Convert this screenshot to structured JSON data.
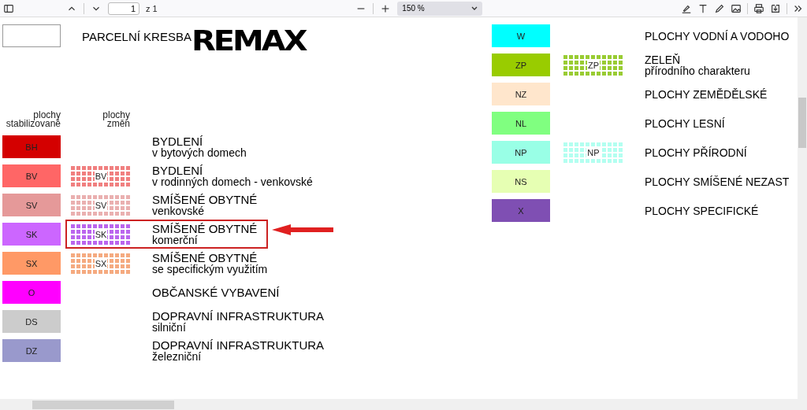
{
  "toolbar": {
    "page_number": "1",
    "page_count": "z 1",
    "zoom": "150 %"
  },
  "page": {
    "title": "PARCELNÍ KRESBA",
    "logo": "REMAX",
    "headers": [
      "plochy\nstabilizované",
      "plochy\nzměn"
    ],
    "left_rows": [
      {
        "code": "BH",
        "color": "#d40000",
        "title": "BYDLENÍ",
        "subtitle": "v bytových domech",
        "highlighted": false
      },
      {
        "code": "BV",
        "color": "#ff6666",
        "hatch": {
          "code": "BV",
          "color": "#f08080"
        },
        "title": "BYDLENÍ",
        "subtitle": "v rodinných domech - venkovské",
        "highlighted": false
      },
      {
        "code": "SV",
        "color": "#e59999",
        "hatch": {
          "code": "SV",
          "color": "#eab0b0"
        },
        "title": "SMÍŠENÉ OBYTNÉ",
        "subtitle": "venkovské",
        "highlighted": false
      },
      {
        "code": "SK",
        "color": "#cc66ff",
        "hatch": {
          "code": "SK",
          "color": "#bb66ee"
        },
        "title": "SMÍŠENÉ OBYTNÉ",
        "subtitle": "komerční",
        "highlighted": true
      },
      {
        "code": "SX",
        "color": "#ff9966",
        "hatch": {
          "code": "SX",
          "color": "#f5aa80"
        },
        "title": "SMÍŠENÉ OBYTNÉ",
        "subtitle": "se specifickým využitím",
        "highlighted": false
      },
      {
        "code": "O",
        "color": "#ff00ff",
        "title": "OBČANSKÉ VYBAVENÍ",
        "highlighted": false
      },
      {
        "code": "DS",
        "color": "#cccccc",
        "title": "DOPRAVNÍ INFRASTRUKTURA",
        "subtitle": "silniční",
        "highlighted": false
      },
      {
        "code": "DZ",
        "color": "#9999cc",
        "title": "DOPRAVNÍ INFRASTRUKTURA",
        "subtitle": "železniční",
        "highlighted": false
      }
    ],
    "right_rows": [
      {
        "code": "W",
        "color": "#00ffff",
        "title": "PLOCHY VODNÍ A VODOHO"
      },
      {
        "code": "ZP",
        "color": "#99cc00",
        "hatch": {
          "code": "ZP",
          "color": "#99cc33"
        },
        "title": "ZELEŇ",
        "subtitle": "přírodního charakteru"
      },
      {
        "code": "NZ",
        "color": "#ffe6cc",
        "title": "PLOCHY ZEMĚDĚLSKÉ"
      },
      {
        "code": "NL",
        "color": "#80ff80",
        "title": "PLOCHY LESNÍ"
      },
      {
        "code": "NP",
        "color": "#99ffe6",
        "hatch": {
          "code": "NP",
          "color": "#b3fff0"
        },
        "title": "PLOCHY PŘÍRODNÍ"
      },
      {
        "code": "NS",
        "color": "#e6ffb3",
        "title": "PLOCHY SMÍŠENÉ NEZAST"
      },
      {
        "code": "X",
        "color": "#7f4fb3",
        "title": "PLOCHY SPECIFICKÉ"
      }
    ]
  }
}
